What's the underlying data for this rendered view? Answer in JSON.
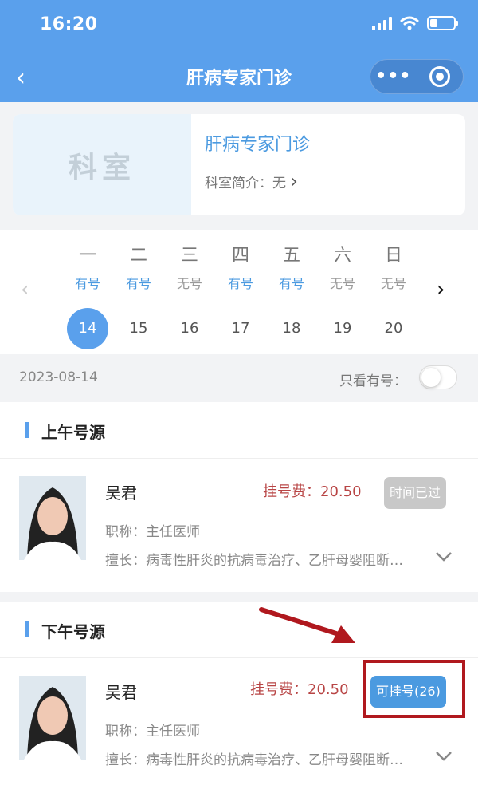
{
  "status_bar": {
    "time": "16:20"
  },
  "nav": {
    "title": "肝病专家门诊",
    "back_icon": "‹",
    "more_icon": "•••"
  },
  "department": {
    "image_text": "科室",
    "name": "肝病专家门诊",
    "intro_label": "科室简介：无",
    "intro_chevron": "›"
  },
  "calendar": {
    "prev_icon": "‹",
    "next_icon": "›",
    "days": [
      {
        "weekday": "一",
        "availability": "有号",
        "available": true,
        "date": "14",
        "selected": true
      },
      {
        "weekday": "二",
        "availability": "有号",
        "available": true,
        "date": "15",
        "selected": false
      },
      {
        "weekday": "三",
        "availability": "无号",
        "available": false,
        "date": "16",
        "selected": false
      },
      {
        "weekday": "四",
        "availability": "有号",
        "available": true,
        "date": "17",
        "selected": false
      },
      {
        "weekday": "五",
        "availability": "有号",
        "available": true,
        "date": "18",
        "selected": false
      },
      {
        "weekday": "六",
        "availability": "无号",
        "available": false,
        "date": "19",
        "selected": false
      },
      {
        "weekday": "日",
        "availability": "无号",
        "available": false,
        "date": "20",
        "selected": false
      }
    ]
  },
  "filter": {
    "date": "2023-08-14",
    "only_available_label": "只看有号：",
    "only_available": false
  },
  "sessions": [
    {
      "title": "上午号源",
      "doctor": {
        "name": "吴君",
        "fee": "挂号费：20.50",
        "title": "职称：主任医师",
        "specialty": "擅长：病毒性肝炎的抗病毒治疗、乙肝母婴阻断、肝硬化及并发症的诊治",
        "button": "时间已过",
        "button_state": "disabled"
      }
    },
    {
      "title": "下午号源",
      "doctor": {
        "name": "吴君",
        "fee": "挂号费：20.50",
        "title": "职称：主任医师",
        "specialty": "擅长：病毒性肝炎的抗病毒治疗、乙肝母婴阻断、肝硬化及并发症的诊治",
        "button": "可挂号(26)",
        "button_state": "enabled"
      }
    }
  ],
  "colors": {
    "primary": "#5aa0ec",
    "accent": "#4b9ae0",
    "fee": "#b84545",
    "annotation": "#b0181e"
  }
}
